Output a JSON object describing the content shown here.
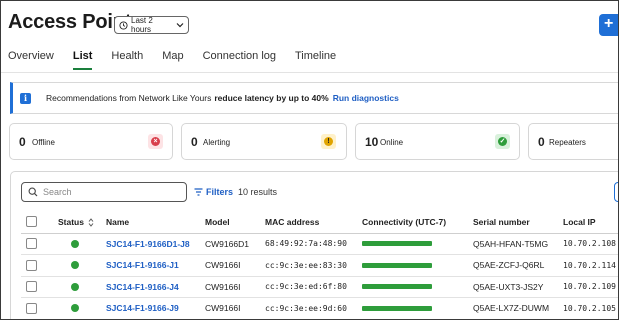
{
  "header": {
    "title": "Access Points",
    "time_range": "Last 2 hours",
    "add_label": "+"
  },
  "tabs": [
    {
      "label": "Overview",
      "active": false
    },
    {
      "label": "List",
      "active": true
    },
    {
      "label": "Health",
      "active": false
    },
    {
      "label": "Map",
      "active": false
    },
    {
      "label": "Connection log",
      "active": false
    },
    {
      "label": "Timeline",
      "active": false
    }
  ],
  "banner": {
    "text": "Recommendations from Network Like Yours",
    "highlight": "reduce latency by up to 40%",
    "link": "Run diagnostics",
    "accent": "#1f6fd6"
  },
  "status_cards": [
    {
      "count": "0",
      "label": "Offline",
      "badge_color": "#d93f4c",
      "badge_bg": "#fde3e5",
      "icon": "x-circle-icon"
    },
    {
      "count": "0",
      "label": "Alerting",
      "badge_color": "#e0a400",
      "badge_bg": "#fff1c9",
      "icon": "warning-circle-icon"
    },
    {
      "count": "10",
      "label": "Online",
      "badge_color": "#2e9d3b",
      "badge_bg": "#d9f1dc",
      "icon": "check-circle-icon"
    },
    {
      "count": "0",
      "label": "Repeaters",
      "badge_color": "#888888",
      "badge_bg": "#eeeeee",
      "icon": ""
    }
  ],
  "toolbar": {
    "search_placeholder": "Search",
    "filters_label": "Filters",
    "results_text": "10 results"
  },
  "table": {
    "columns": [
      "Status",
      "Name",
      "Model",
      "MAC address",
      "Connectivity (UTC-7)",
      "Serial number",
      "Local IP"
    ],
    "rows": [
      {
        "name": "SJC14-F1-9166D1-J8",
        "model": "CW9166D1",
        "mac": "68:49:92:7a:48:90",
        "serial": "Q5AH-HFAN-T5MG",
        "ip": "10.70.2.108",
        "connectivity": 1.0
      },
      {
        "name": "SJC14-F1-9166-J1",
        "model": "CW9166I",
        "mac": "cc:9c:3e:ee:83:30",
        "serial": "Q5AE-ZCFJ-Q6RL",
        "ip": "10.70.2.114",
        "connectivity": 1.0
      },
      {
        "name": "SJC14-F1-9166-J4",
        "model": "CW9166I",
        "mac": "cc:9c:3e:ed:6f:80",
        "serial": "Q5AE-UXT3-JS2Y",
        "ip": "10.70.2.109",
        "connectivity": 1.0
      },
      {
        "name": "SJC14-F1-9166-J9",
        "model": "CW9166I",
        "mac": "cc:9c:3e:ee:9d:60",
        "serial": "Q5AE-LX7Z-DUWM",
        "ip": "10.70.2.105",
        "connectivity": 1.0
      }
    ]
  },
  "colors": {
    "link": "#1f5fc4",
    "online": "#2e9d3b",
    "tab_underline": "#1a7f3c"
  }
}
